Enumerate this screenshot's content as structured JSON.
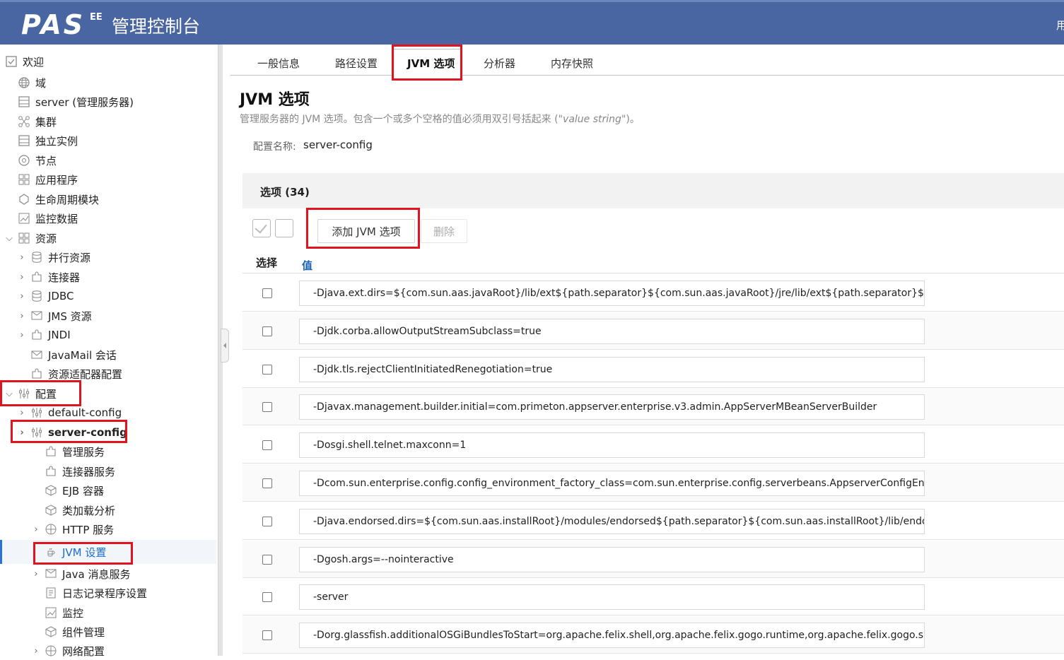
{
  "header": {
    "logo": "PAS",
    "logo_sup": "EE",
    "title": "管理控制台",
    "user_stub": "用"
  },
  "sidebar": {
    "items": [
      {
        "label": "欢迎"
      },
      {
        "label": "域"
      },
      {
        "label": "server (管理服务器)"
      },
      {
        "label": "集群"
      },
      {
        "label": "独立实例"
      },
      {
        "label": "节点"
      },
      {
        "label": "应用程序"
      },
      {
        "label": "生命周期模块"
      },
      {
        "label": "监控数据"
      },
      {
        "label": "资源"
      },
      {
        "label": "并行资源"
      },
      {
        "label": "连接器"
      },
      {
        "label": "JDBC"
      },
      {
        "label": "JMS 资源"
      },
      {
        "label": "JNDI"
      },
      {
        "label": "JavaMail 会话"
      },
      {
        "label": "资源适配器配置"
      },
      {
        "label": "配置"
      },
      {
        "label": "default-config"
      },
      {
        "label": "server-config"
      },
      {
        "label": "管理服务"
      },
      {
        "label": "连接器服务"
      },
      {
        "label": "EJB 容器"
      },
      {
        "label": "类加载分析"
      },
      {
        "label": "HTTP 服务"
      },
      {
        "label": "JVM 设置"
      },
      {
        "label": "Java 消息服务"
      },
      {
        "label": "日志记录程序设置"
      },
      {
        "label": "监控"
      },
      {
        "label": "组件管理"
      },
      {
        "label": "网络配置"
      }
    ]
  },
  "tabs": [
    {
      "label": "一般信息"
    },
    {
      "label": "路径设置"
    },
    {
      "label": "JVM 选项"
    },
    {
      "label": "分析器"
    },
    {
      "label": "内存快照"
    }
  ],
  "page": {
    "title": "JVM 选项",
    "description_prefix": "管理服务器的 JVM 选项。包含一个或多个空格的值必须用双引号括起来 (\"",
    "description_italic": "value string",
    "description_suffix": "\")。",
    "config_label": "配置名称:",
    "config_value": "server-config"
  },
  "table": {
    "title": "选项 (34)",
    "add_button": "添加 JVM 选项",
    "delete_button": "删除",
    "col_select": "选择",
    "col_value": "值",
    "rows": [
      {
        "value": "-Djava.ext.dirs=${com.sun.aas.javaRoot}/lib/ext${path.separator}${com.sun.aas.javaRoot}/jre/lib/ext${path.separator}${com.sun"
      },
      {
        "value": "-Djdk.corba.allowOutputStreamSubclass=true"
      },
      {
        "value": "-Djdk.tls.rejectClientInitiatedRenegotiation=true"
      },
      {
        "value": "-Djavax.management.builder.initial=com.primeton.appserver.enterprise.v3.admin.AppServerMBeanServerBuilder"
      },
      {
        "value": "-Dosgi.shell.telnet.maxconn=1"
      },
      {
        "value": "-Dcom.sun.enterprise.config.config_environment_factory_class=com.sun.enterprise.config.serverbeans.AppserverConfigEnvi"
      },
      {
        "value": "-Djava.endorsed.dirs=${com.sun.aas.installRoot}/modules/endorsed${path.separator}${com.sun.aas.installRoot}/lib/endorsed"
      },
      {
        "value": "-Dgosh.args=--nointeractive"
      },
      {
        "value": "-server"
      },
      {
        "value": "-Dorg.glassfish.additionalOSGiBundlesToStart=org.apache.felix.shell,org.apache.felix.gogo.runtime,org.apache.felix.gogo.she"
      }
    ]
  },
  "colors": {
    "header_bg": "#4a66a2",
    "highlight_box": "#e0141e",
    "selected_link": "#1a6fd0"
  }
}
